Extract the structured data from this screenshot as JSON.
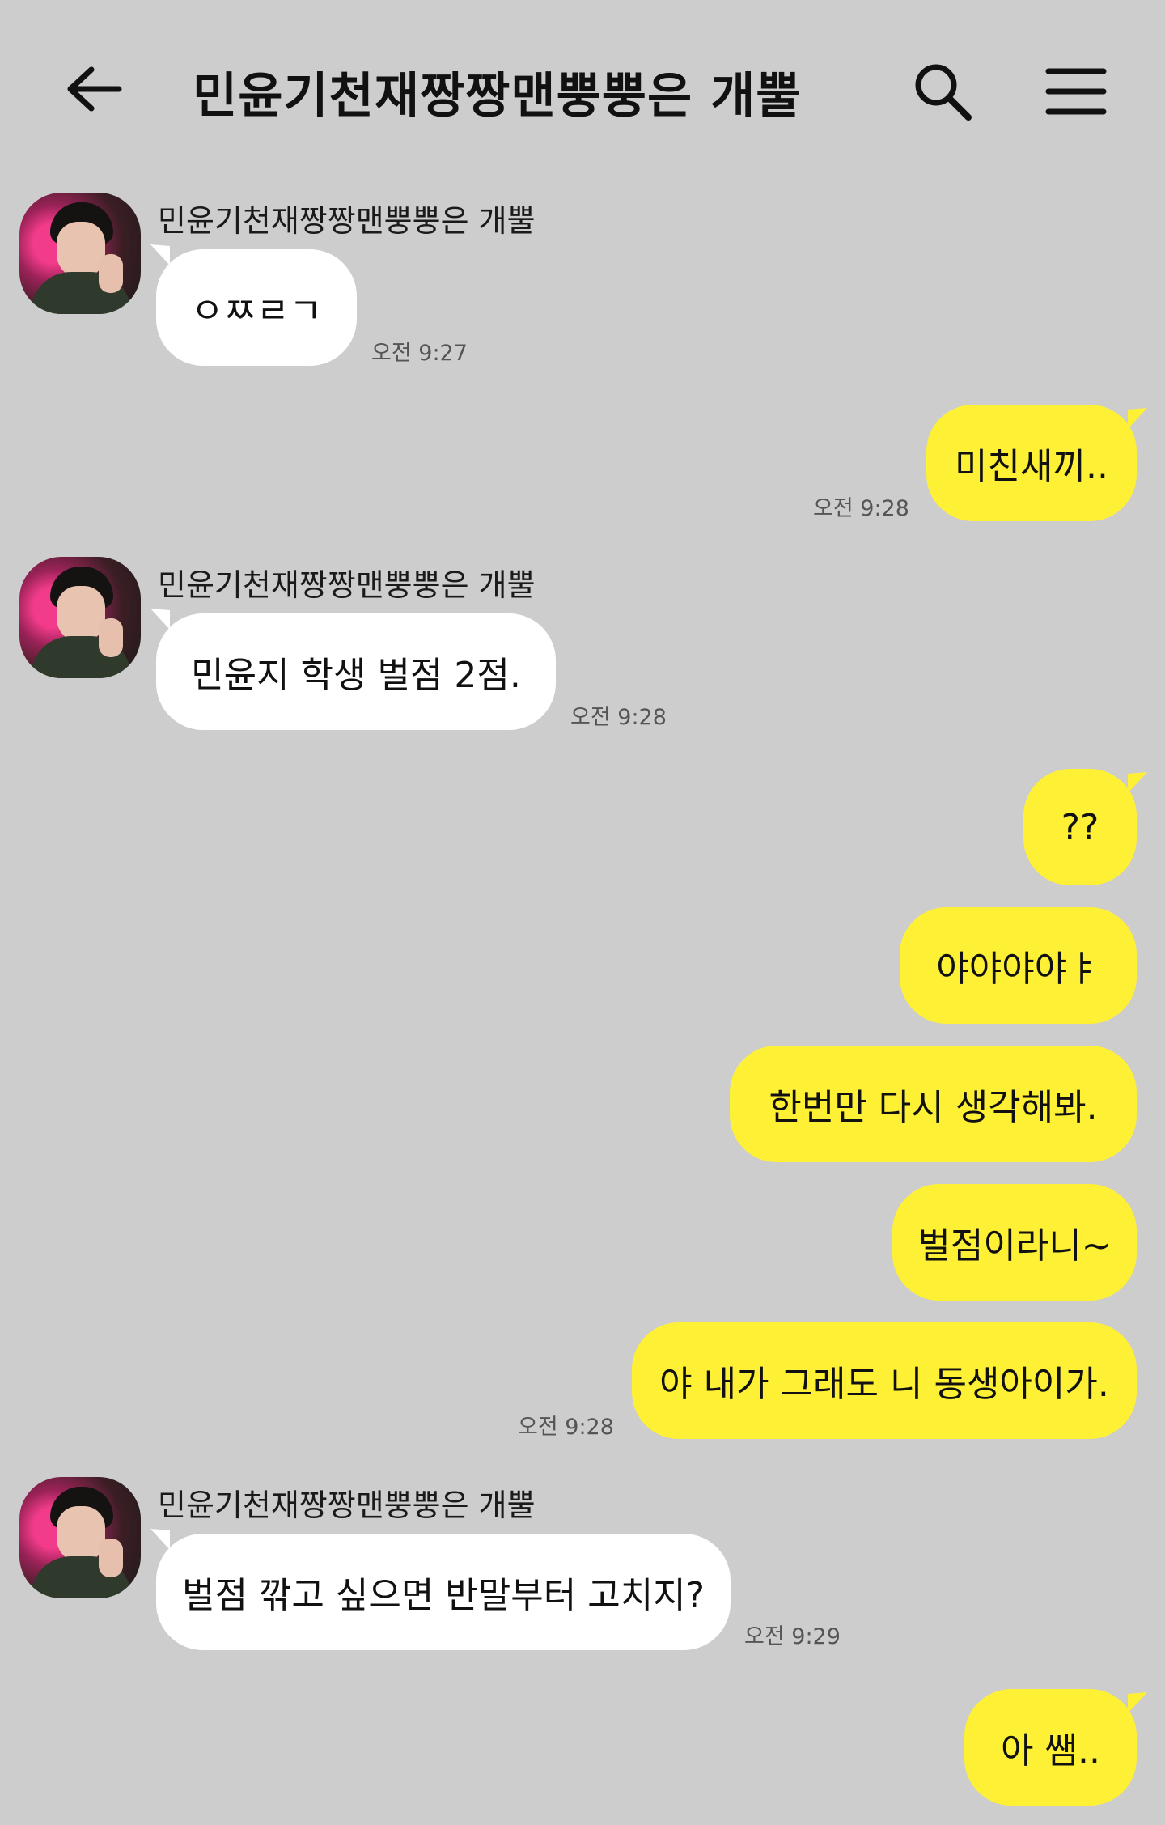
{
  "header": {
    "title": "민윤기천재짱짱맨뿡뿡은 개뿔"
  },
  "messages": [
    {
      "type": "incoming",
      "sender": "민윤기천재짱짱맨뿡뿡은 개뿔",
      "text": "ㅇㅉㄹㄱ",
      "time": "오전 9:27"
    },
    {
      "type": "outgoing",
      "text": "미친새끼..",
      "time": "오전 9:28"
    },
    {
      "type": "incoming",
      "sender": "민윤기천재짱짱맨뿡뿡은 개뿔",
      "text": "민윤지 학생 벌점 2점.",
      "time": "오전 9:28"
    },
    {
      "type": "outgoing",
      "text": "??"
    },
    {
      "type": "outgoing",
      "text": "야야야야ㅑ"
    },
    {
      "type": "outgoing",
      "text": "한번만 다시 생각해봐."
    },
    {
      "type": "outgoing",
      "text": "벌점이라니~"
    },
    {
      "type": "outgoing",
      "text": "야 내가 그래도 니 동생아이가.",
      "time": "오전 9:28"
    },
    {
      "type": "incoming",
      "sender": "민윤기천재짱짱맨뿡뿡은 개뿔",
      "text": "벌점 깎고 싶으면 반말부터 고치지?",
      "time": "오전 9:29"
    },
    {
      "type": "outgoing",
      "text": "아 쌤.."
    }
  ]
}
